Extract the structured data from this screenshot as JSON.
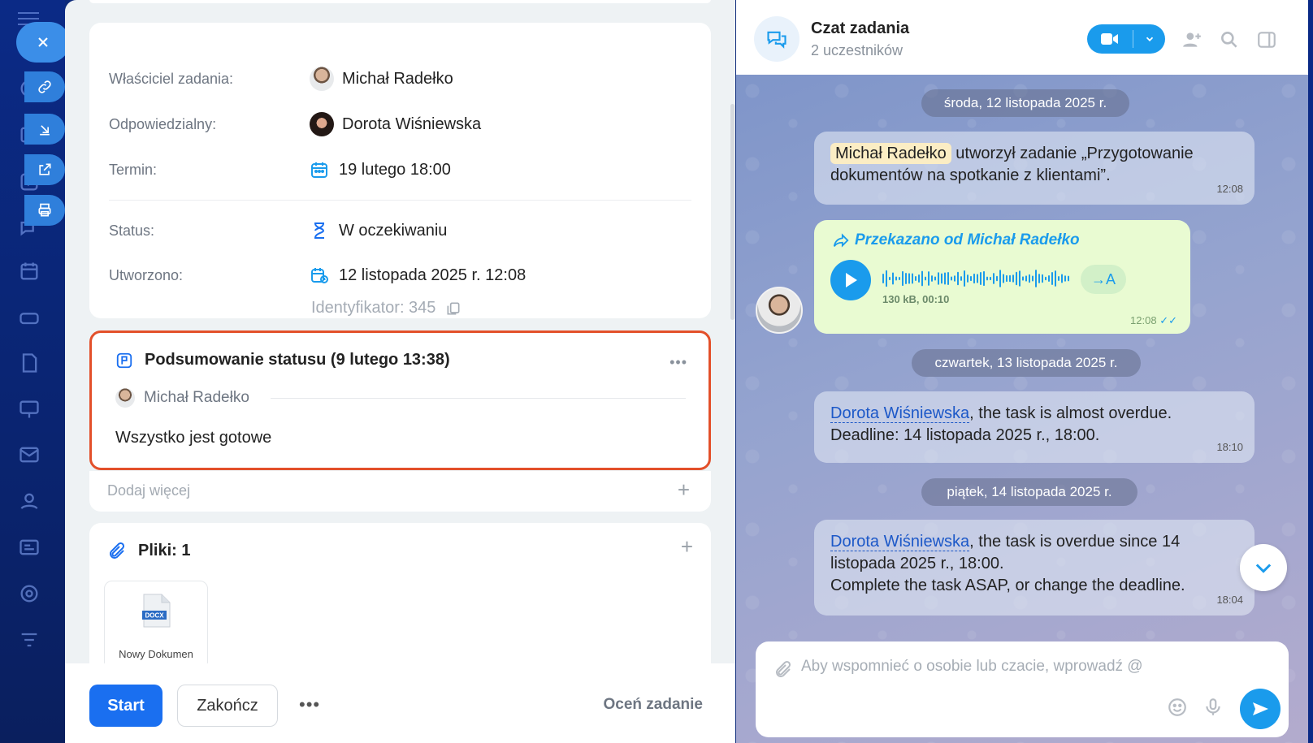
{
  "task": {
    "owner_label": "Właściciel zadania:",
    "owner_name": "Michał Radełko",
    "responsible_label": "Odpowiedzialny:",
    "responsible_name": "Dorota Wiśniewska",
    "deadline_label": "Termin:",
    "deadline_value": "19 lutego 18:00",
    "status_label": "Status:",
    "status_value": "W oczekiwaniu",
    "created_label": "Utworzono:",
    "created_value": "12 listopada 2025 r. 12:08",
    "identifier": "Identyfikator: 345"
  },
  "summary": {
    "title": "Podsumowanie statusu (9 lutego 13:38)",
    "more": "•••",
    "author": "Michał Radełko",
    "text": "Wszystko jest gotowe"
  },
  "add_more": {
    "label": "Dodaj więcej",
    "plus": "+"
  },
  "files": {
    "title": "Pliki: 1",
    "plus": "+",
    "items": [
      {
        "badge": "DOCX",
        "name": "Nowy Dokumen"
      }
    ]
  },
  "footer": {
    "start": "Start",
    "finish": "Zakończ",
    "more": "•••",
    "rate": "Oceń zadanie"
  },
  "chat": {
    "title": "Czat zadania",
    "subtitle": "2 uczestników",
    "dates": [
      "środa, 12 listopada 2025 r.",
      "czwartek, 13 listopada 2025 r.",
      "piątek, 14 listopada 2025 r."
    ],
    "msg1": {
      "mention": "Michał Radełko",
      "text_a": " utworzył zadanie „Przygotowanie",
      "text_b": "dokumentów na spotkanie z klientami”.",
      "time": "12:08"
    },
    "forwarded": {
      "label": "Przekazano od Michał Radełko",
      "meta": "130 kB, 00:10",
      "transcribe": "→A",
      "time": "12:08"
    },
    "msg2": {
      "mention": "Dorota Wiśniewska",
      "text_a": ", the task is almost overdue.",
      "text_b": "Deadline: 14 listopada 2025 r., 18:00.",
      "time": "18:10"
    },
    "msg3": {
      "mention": "Dorota Wiśniewska",
      "text_a": ", the task is overdue since 14",
      "text_b": "listopada 2025 r., 18:00.",
      "text_c": "Complete the task ASAP, or change the deadline.",
      "time": "18:04"
    },
    "composer_placeholder": "Aby wspomnieć o osobie lub czacie, wprowadź @"
  },
  "colors": {
    "accent": "#1a6ff0",
    "chat_accent": "#1a9bec",
    "highlight_border": "#e3502a"
  }
}
